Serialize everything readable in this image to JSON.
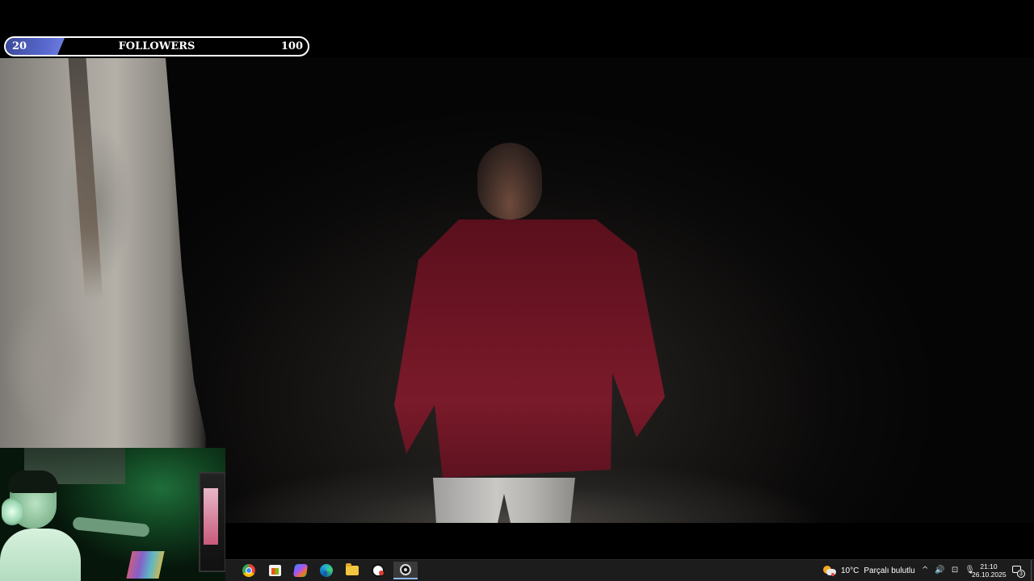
{
  "followers_bar": {
    "min": "20",
    "label": "FOLLOWERS",
    "max": "100"
  },
  "taskbar": {
    "apps": [
      {
        "name": "chrome-icon",
        "active": false
      },
      {
        "name": "store-icon",
        "active": false
      },
      {
        "name": "copilot-icon",
        "active": false
      },
      {
        "name": "edge-icon",
        "active": false
      },
      {
        "name": "file-explorer-icon",
        "active": false
      },
      {
        "name": "obs-icon",
        "active": false
      },
      {
        "name": "app-icon",
        "active": true
      }
    ],
    "weather": {
      "temperature": "10°C",
      "condition": "Parçalı bulutlu"
    },
    "tray": {
      "chevron": "^",
      "volume": "🔊",
      "network": "⊡",
      "microphone": "🎙"
    },
    "clock": {
      "time": "21:10",
      "date": "26.10.2025"
    },
    "notifications": {
      "count": "3"
    }
  },
  "colors": {
    "taskbar_bg": "#1c1c1c",
    "progress_fill": "#5a6ad0",
    "active_indicator": "#8fb8e6"
  }
}
